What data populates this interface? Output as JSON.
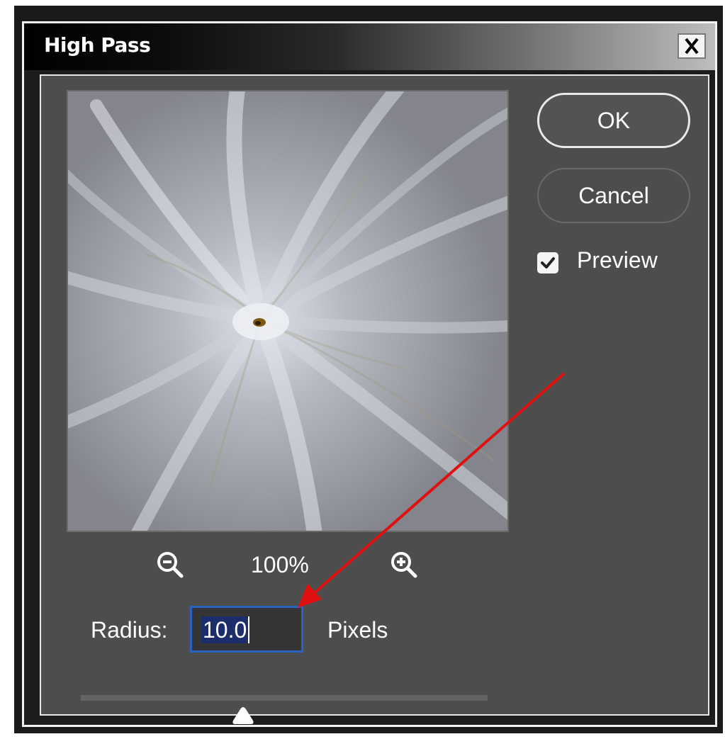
{
  "dialog": {
    "title": "High Pass",
    "close_icon": "close-icon"
  },
  "preview": {
    "zoom_level": "100%",
    "zoom_out_icon": "zoom-out-icon",
    "zoom_in_icon": "zoom-in-icon"
  },
  "buttons": {
    "ok_label": "OK",
    "cancel_label": "Cancel"
  },
  "preview_toggle": {
    "label": "Preview",
    "checked": true
  },
  "radius": {
    "label": "Radius:",
    "value": "10.0",
    "units": "Pixels"
  },
  "colors": {
    "dialog_bg": "#4d4d4d",
    "input_focus": "#2b63c4",
    "selection": "#1c2d6b",
    "annotation": "#e01010"
  }
}
